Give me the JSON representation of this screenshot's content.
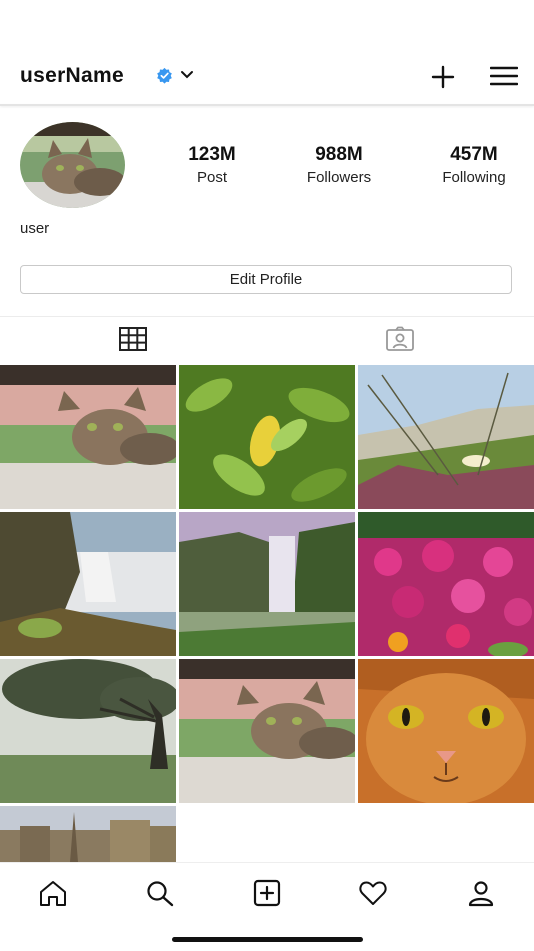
{
  "header": {
    "username": "userName",
    "verified_color": "#3897f0"
  },
  "profile": {
    "bio_name": "user",
    "stats": [
      {
        "value": "123M",
        "label": "Post"
      },
      {
        "value": "988M",
        "label": "Followers"
      },
      {
        "value": "457M",
        "label": "Following"
      }
    ],
    "edit_label": "Edit Profile"
  },
  "tabs": [
    {
      "icon": "grid-icon",
      "active": true
    },
    {
      "icon": "tagged-icon",
      "active": false
    }
  ],
  "posts": [
    "cat-on-railing",
    "green-leaves",
    "dune-grass-flowers",
    "waterfall-rocks",
    "misty-waterfall",
    "pink-flowers",
    "foggy-tree",
    "cat-on-railing",
    "orange-cat-face",
    "city-skyline"
  ],
  "bottom_nav": [
    "home-icon",
    "search-icon",
    "add-post-icon",
    "heart-icon",
    "profile-icon"
  ]
}
